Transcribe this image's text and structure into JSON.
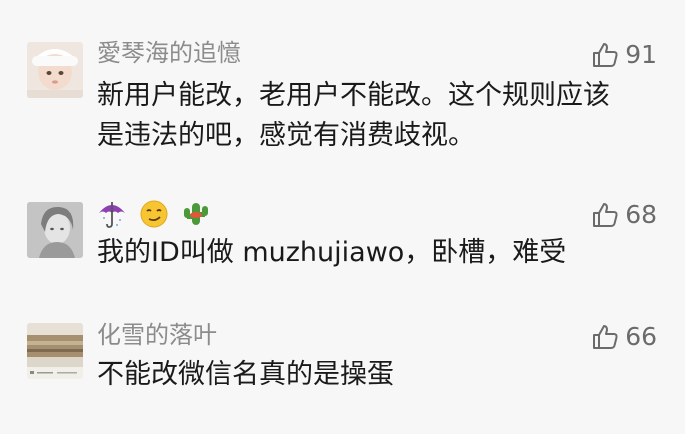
{
  "comments": [
    {
      "nickname": "愛琴海的追憶",
      "text": "新用户能改，老用户不能改。这个规则应该\n是违法的吧，感觉有消费歧视。",
      "likes": "91",
      "avatar": "baby-photo-avatar"
    },
    {
      "nickname_emojis": [
        "umbrella-icon",
        "smirk-face-icon",
        "cactus-icon"
      ],
      "text": "我的ID叫做 muzhujiawo，卧槽，难受",
      "likes": "68",
      "avatar": "grayscale-portrait-avatar"
    },
    {
      "nickname": "化雪的落叶",
      "text": "不能改微信名真的是操蛋",
      "likes": "66",
      "avatar": "landscape-photo-avatar"
    }
  ],
  "colors": {
    "background": "#f7f7f7",
    "nickname": "#8c8c8c",
    "text": "#1a1a1a",
    "like": "#6b6b6b"
  }
}
